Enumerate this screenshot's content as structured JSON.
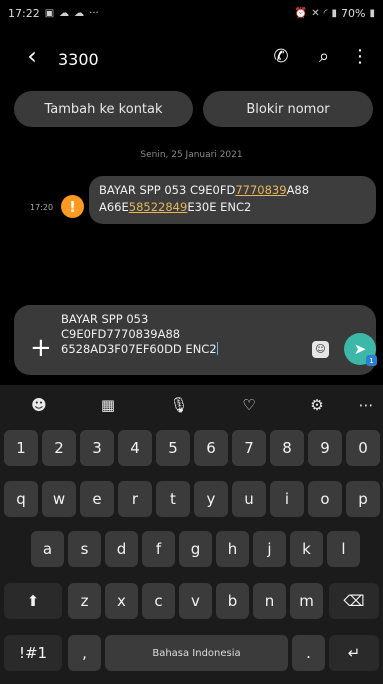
{
  "status_bar": {
    "time": "17:22",
    "notification_icons": [
      "image-icon",
      "cloud-icon",
      "cloud-icon"
    ],
    "more": "···",
    "battery": "70%"
  },
  "header": {
    "back_icon": "chevron-left-icon",
    "title": "3300",
    "call_icon": "phone-icon",
    "search_icon": "search-icon",
    "menu_icon": "more-vertical-icon"
  },
  "actions": {
    "add_contact": "Tambah ke kontak",
    "block_number": "Blokir nomor"
  },
  "conversation": {
    "date_divider": "Senin, 25 Januari 2021",
    "message": {
      "time": "17:20",
      "status": "!",
      "line1_prefix": "BAYAR SPP 053 C9E0FD",
      "line1_link": "7770839",
      "line1_suffix": "A88",
      "line2_prefix": "A66E",
      "line2_link": "58522849",
      "line2_suffix": "E30E ENC2"
    }
  },
  "composer": {
    "plus": "+",
    "draft_text": "BAYAR SPP 053\nC9E0FD7770839A88\n6528AD3F07EF60DD ENC2",
    "sim_badge": "1"
  },
  "keyboard": {
    "toolbar": [
      "emoji-icon",
      "sticker-icon",
      "mic-icon",
      "heart-icon",
      "settings-icon",
      "more-icon"
    ],
    "row_numbers": [
      "1",
      "2",
      "3",
      "4",
      "5",
      "6",
      "7",
      "8",
      "9",
      "0"
    ],
    "row1": [
      "q",
      "w",
      "e",
      "r",
      "t",
      "y",
      "u",
      "i",
      "o",
      "p"
    ],
    "row2": [
      "a",
      "s",
      "d",
      "f",
      "g",
      "h",
      "j",
      "k",
      "l"
    ],
    "row3": [
      "z",
      "x",
      "c",
      "v",
      "b",
      "n",
      "m"
    ],
    "symbols_label": "!#1",
    "comma": ",",
    "space_label": "Bahasa Indonesia",
    "period": ".",
    "shift_icon": "shift-icon",
    "backspace_icon": "backspace-icon",
    "enter_icon": "enter-icon"
  }
}
